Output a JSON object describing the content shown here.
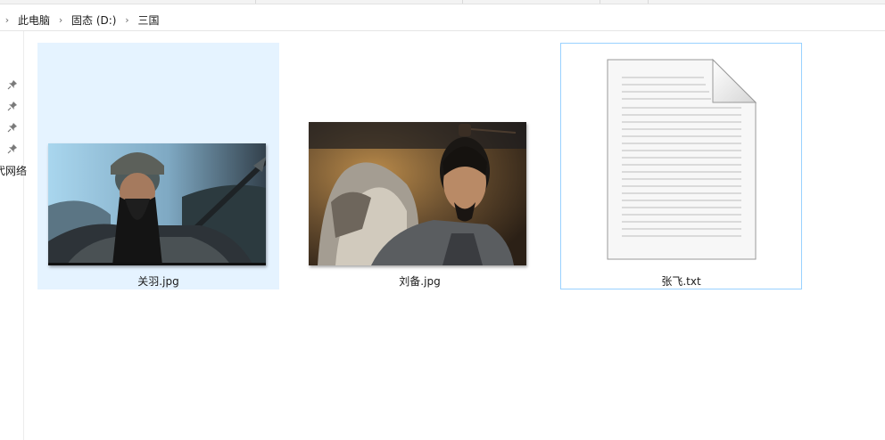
{
  "breadcrumb": {
    "items": [
      "此电脑",
      "固态 (D:)",
      "三国"
    ]
  },
  "navpane": {
    "cut_label": "代网络"
  },
  "files": [
    {
      "name": "关羽.jpg",
      "type": "image",
      "selected": true
    },
    {
      "name": "刘备.jpg",
      "type": "image",
      "selected": false
    },
    {
      "name": "张飞.txt",
      "type": "text",
      "focused": true
    }
  ],
  "colors": {
    "selection_bg": "#e5f3ff",
    "focus_border": "#99d1ff"
  }
}
